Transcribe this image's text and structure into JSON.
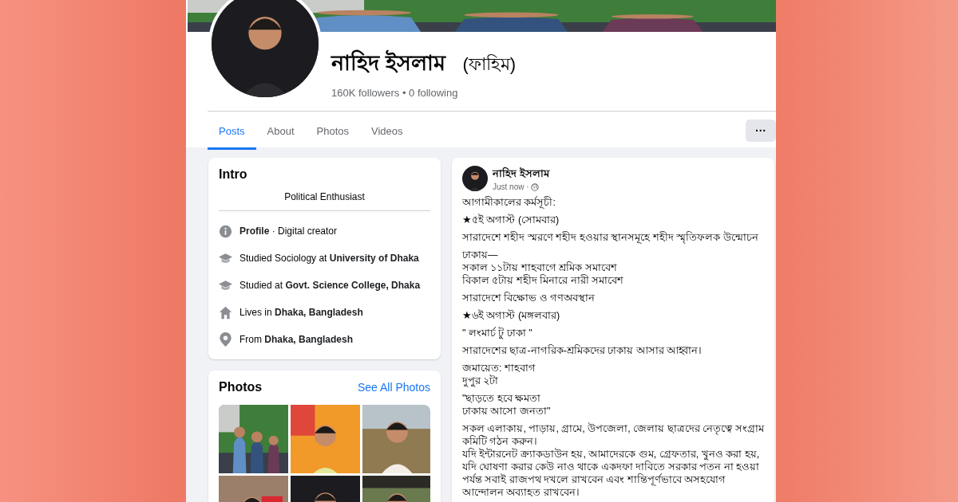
{
  "profile": {
    "name": "নাহিদ ইসলাম",
    "alt_name": "(ফাহিম)",
    "stats": "160K followers • 0 following"
  },
  "tabs": [
    {
      "label": "Posts",
      "selected": true
    },
    {
      "label": "About",
      "selected": false
    },
    {
      "label": "Photos",
      "selected": false
    },
    {
      "label": "Videos",
      "selected": false
    }
  ],
  "more_button": "···",
  "intro": {
    "title": "Intro",
    "bio": "Political Enthusiast",
    "items": [
      {
        "kind": "info",
        "text": "**Profile** · Digital creator"
      },
      {
        "kind": "school",
        "text": "Studied Sociology at **University of Dhaka**"
      },
      {
        "kind": "school",
        "text": "Studied at **Govt. Science College, Dhaka**"
      },
      {
        "kind": "home",
        "text": "Lives in **Dhaka, Bangladesh**"
      },
      {
        "kind": "pin",
        "text": "From **Dhaka, Bangladesh**"
      }
    ]
  },
  "photos": {
    "title": "Photos",
    "link": "See All Photos"
  },
  "post": {
    "author": "নাহিদ ইসলাম",
    "time": "Just now ·",
    "paragraphs": [
      [
        "আগামীকালের কর্মসূচী:"
      ],
      [
        "★৫ই অগাস্ট (সোমবার)"
      ],
      [
        "সারাদেশে শহীদ স্মরণে শহীদ হওয়ার স্থানসমূহে শহীদ স্মৃতিফলক উন্মোচন"
      ],
      [
        "ঢাকায়—",
        "সকাল ১১টায় শাহবাগে শ্রমিক সমাবেশ",
        "বিকাল ৫টায় শহীদ মিনারে নারী সমাবেশ"
      ],
      [
        "সারাদেশে বিক্ষোভ ও গণঅবস্থান"
      ],
      [
        "★৬ই অগাস্ট (মঙ্গলবার)"
      ],
      [
        "\" লংমার্চ টু ঢাকা \""
      ],
      [
        "সারাদেশের ছাত্র-নাগরিক-শ্রমিকদের ঢাকায় আসার আহ্বান।"
      ],
      [
        "জমায়েত: শাহবাগ",
        "দুপুর ২টা"
      ],
      [
        "\"ছাড়তে হবে ক্ষমতা",
        "ঢাকায় আসো জনতা\""
      ],
      [
        "সকল এলাকায়, পাড়ায়, গ্রামে, উপজেলা, জেলায় ছাত্রদের নেতৃত্বে সংগ্রাম কমিটি গঠন করুন।",
        "যদি ইন্টারনেট ক্র্যাকডাউন হয়, আমাদেরকে গুম, গ্রেফতার, খুনও করা হয়, যদি ঘোষণা করার কেউ নাও থাকে একদফা দাবিতে সরকার পতন না হওয়া পর্যন্ত সবাই রাজপথ দখলে রাখবেন এবং শান্তিপূর্ণভাবে অসহযোগ আন্দোলন অব্যাহত রাখবেন।"
      ]
    ]
  }
}
